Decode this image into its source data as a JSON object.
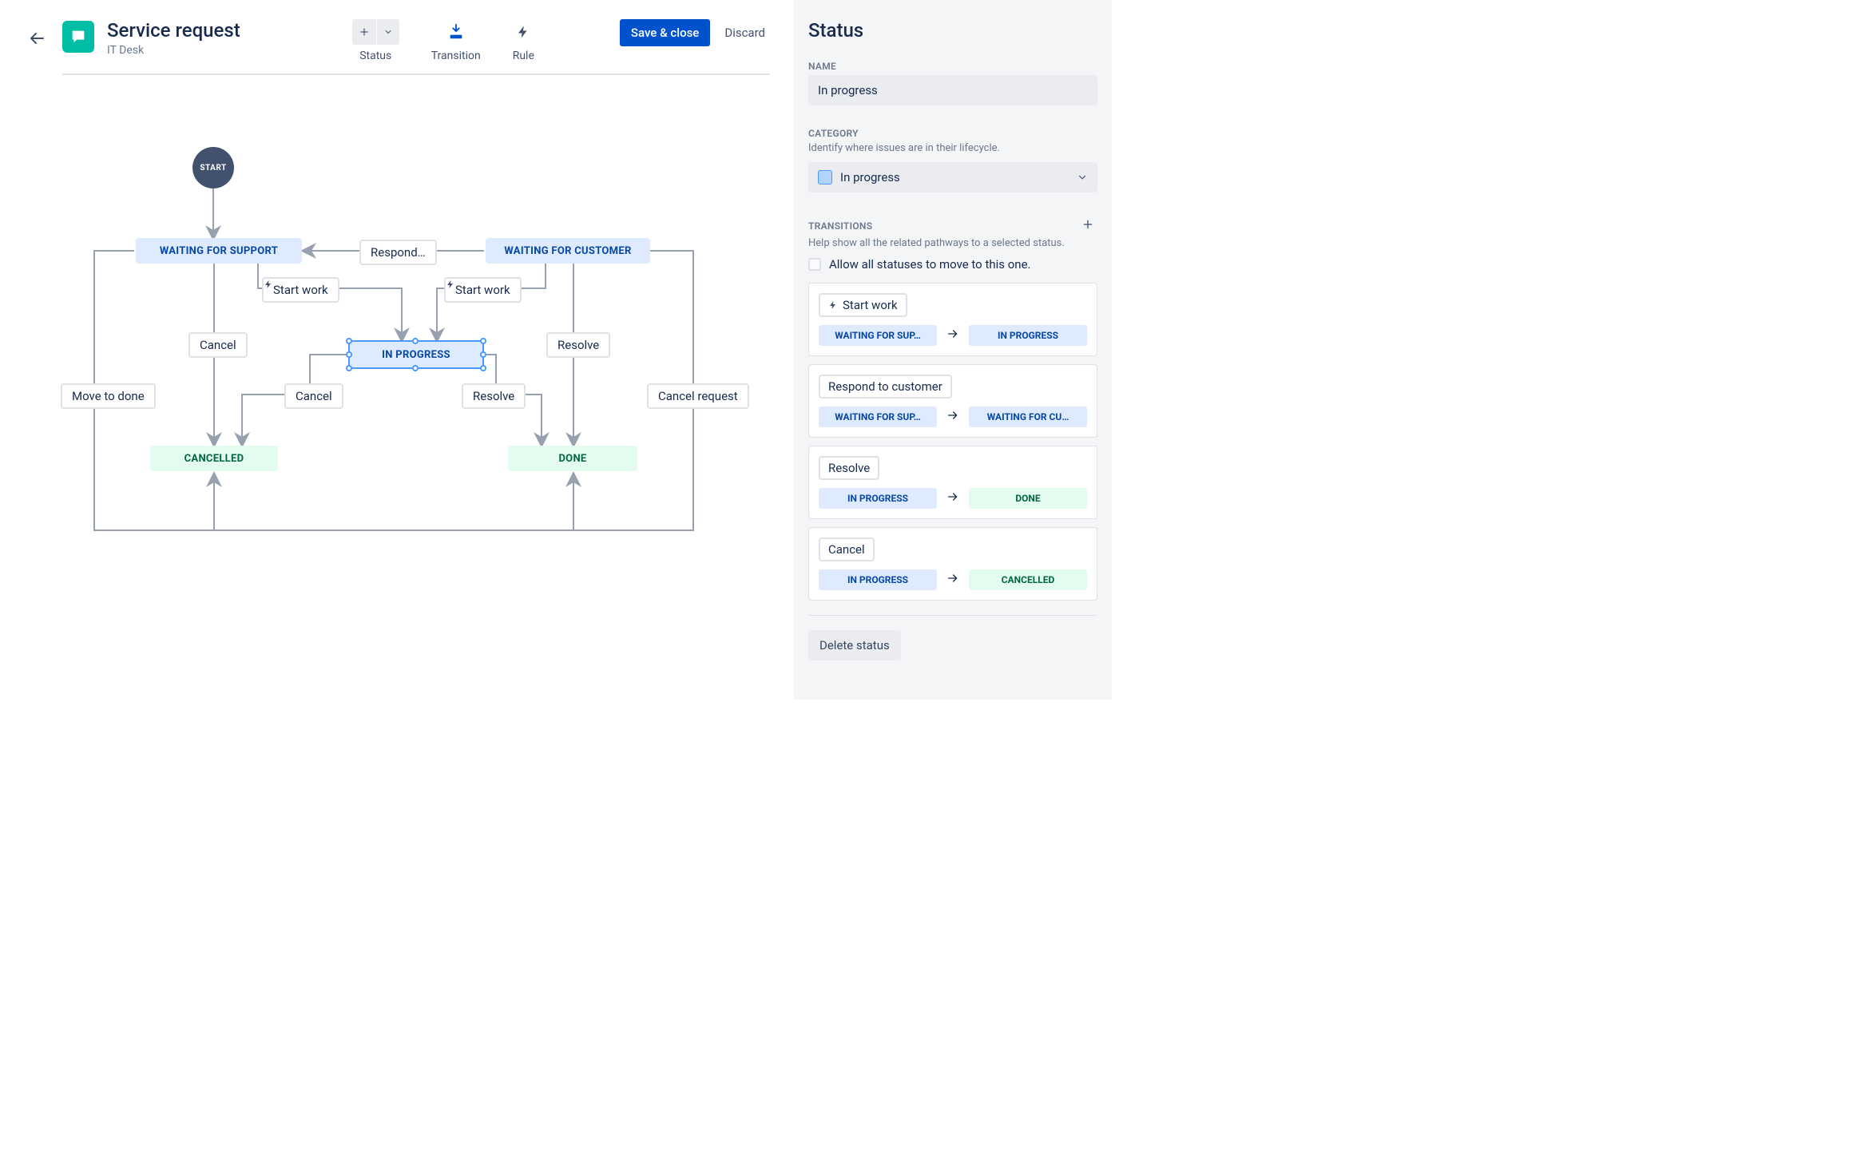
{
  "header": {
    "title": "Service request",
    "subtitle": "IT Desk"
  },
  "toolbar": {
    "status": "Status",
    "transition": "Transition",
    "rule": "Rule"
  },
  "actions": {
    "save": "Save & close",
    "discard": "Discard"
  },
  "workflow": {
    "start": "START",
    "nodes": {
      "waiting_support": "WAITING FOR SUPPORT",
      "waiting_customer": "WAITING FOR CUSTOMER",
      "in_progress": "IN PROGRESS",
      "cancelled": "CANCELLED",
      "done": "DONE"
    },
    "labels": {
      "respond": "Respond…",
      "start_work_left": "Start work",
      "start_work_right": "Start work",
      "cancel1": "Cancel",
      "cancel2": "Cancel",
      "resolve1": "Resolve",
      "resolve2": "Resolve",
      "move_to_done": "Move to done",
      "cancel_request": "Cancel request"
    }
  },
  "panel": {
    "title": "Status",
    "name_label": "NAME",
    "name_value": "In progress",
    "category_label": "CATEGORY",
    "category_note": "Identify where issues are in their lifecycle.",
    "category_value": "In progress",
    "transitions_label": "TRANSITIONS",
    "transitions_note": "Help show all the related pathways to a selected status.",
    "allow_all": "Allow all statuses to move to this one.",
    "delete": "Delete status",
    "list": [
      {
        "name": "Start work",
        "rule": true,
        "from": "WAITING FOR SUP…",
        "from_cat": "blue",
        "to": "IN PROGRESS",
        "to_cat": "blue"
      },
      {
        "name": "Respond to customer",
        "rule": false,
        "from": "WAITING FOR SUP…",
        "from_cat": "blue",
        "to": "WAITING FOR CU…",
        "to_cat": "blue"
      },
      {
        "name": "Resolve",
        "rule": false,
        "from": "IN PROGRESS",
        "from_cat": "blue",
        "to": "DONE",
        "to_cat": "green"
      },
      {
        "name": "Cancel",
        "rule": false,
        "from": "IN PROGRESS",
        "from_cat": "blue",
        "to": "CANCELLED",
        "to_cat": "green"
      }
    ]
  }
}
